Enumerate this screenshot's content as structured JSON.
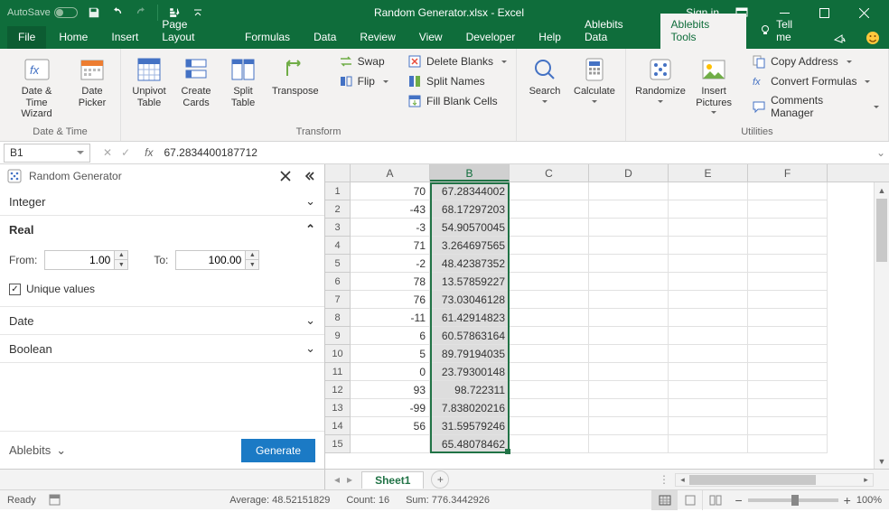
{
  "titlebar": {
    "autosave": "AutoSave",
    "title": "Random Generator.xlsx - Excel",
    "signin": "Sign in"
  },
  "tabs": {
    "file": "File",
    "items": [
      "Home",
      "Insert",
      "Page Layout",
      "Formulas",
      "Data",
      "Review",
      "View",
      "Developer",
      "Help",
      "Ablebits Data",
      "Ablebits Tools"
    ],
    "active_index": 10,
    "tell": "Tell me"
  },
  "ribbon": {
    "groups": {
      "datetime": {
        "label": "Date & Time",
        "date_time_wizard": "Date &\nTime Wizard",
        "date_picker": "Date\nPicker"
      },
      "transform": {
        "label": "Transform",
        "unpivot": "Unpivot\nTable",
        "create_cards": "Create\nCards",
        "split_table": "Split\nTable",
        "transpose": "Transpose",
        "swap": "Swap",
        "flip": "Flip",
        "delete_blanks": "Delete Blanks",
        "split_names": "Split Names",
        "fill_blank": "Fill Blank Cells"
      },
      "misc": {
        "search": "Search",
        "calculate": "Calculate",
        "randomize": "Randomize",
        "insert_pictures": "Insert\nPictures"
      },
      "utilities": {
        "label": "Utilities",
        "copy_addr": "Copy Address",
        "convert": "Convert Formulas",
        "comments": "Comments Manager"
      }
    }
  },
  "formula_bar": {
    "name": "B1",
    "value": "67.2834400187712"
  },
  "pane": {
    "title": "Random Generator",
    "sections": {
      "integer": "Integer",
      "real": "Real",
      "date": "Date",
      "boolean": "Boolean"
    },
    "real": {
      "from_lbl": "From:",
      "from_val": "1.00",
      "to_lbl": "To:",
      "to_val": "100.00",
      "unique": "Unique values"
    },
    "brand": "Ablebits",
    "generate": "Generate"
  },
  "grid": {
    "cols": [
      "A",
      "B",
      "C",
      "D",
      "E",
      "F"
    ],
    "rows": [
      {
        "n": 1,
        "A": "70",
        "B": "67.28344002"
      },
      {
        "n": 2,
        "A": "-43",
        "B": "68.17297203"
      },
      {
        "n": 3,
        "A": "-3",
        "B": "54.90570045"
      },
      {
        "n": 4,
        "A": "71",
        "B": "3.264697565"
      },
      {
        "n": 5,
        "A": "-2",
        "B": "48.42387352"
      },
      {
        "n": 6,
        "A": "78",
        "B": "13.57859227"
      },
      {
        "n": 7,
        "A": "76",
        "B": "73.03046128"
      },
      {
        "n": 8,
        "A": "-11",
        "B": "61.42914823"
      },
      {
        "n": 9,
        "A": "6",
        "B": "60.57863164"
      },
      {
        "n": 10,
        "A": "5",
        "B": "89.79194035"
      },
      {
        "n": 11,
        "A": "0",
        "B": "23.79300148"
      },
      {
        "n": 12,
        "A": "93",
        "B": "98.722311"
      },
      {
        "n": 13,
        "A": "-99",
        "B": "7.838020216"
      },
      {
        "n": 14,
        "A": "56",
        "B": "31.59579246"
      },
      {
        "n": 15,
        "A": "",
        "B": "65.48078462"
      }
    ]
  },
  "sheets": {
    "active": "Sheet1"
  },
  "status": {
    "ready": "Ready",
    "average": "Average: 48.52151829",
    "count": "Count: 16",
    "sum": "Sum: 776.3442926",
    "zoom": "100%"
  }
}
